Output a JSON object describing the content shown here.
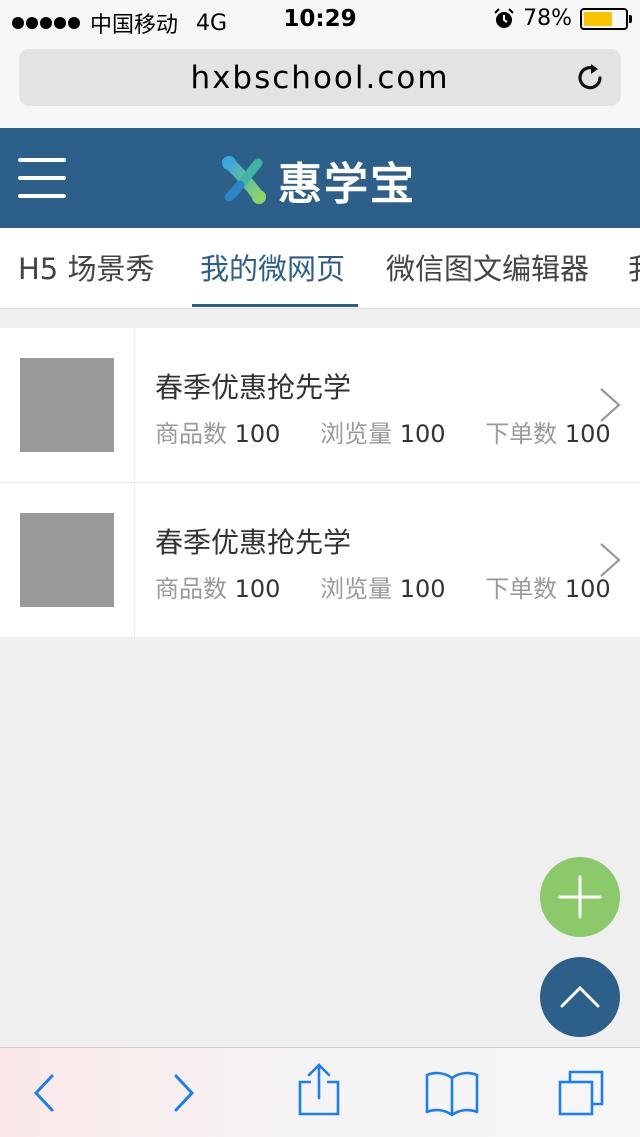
{
  "status_bar": {
    "carrier": "中国移动",
    "network": "4G",
    "time": "10:29",
    "battery": "78%",
    "battery_level": 0.78
  },
  "browser": {
    "url": "hxbschool.com"
  },
  "header": {
    "logo_text": "惠学宝"
  },
  "tabs": [
    {
      "label": "H5 场景秀"
    },
    {
      "label": "我的微网页"
    },
    {
      "label": "微信图文编辑器"
    },
    {
      "label": "我"
    }
  ],
  "list": [
    {
      "title": "春季优惠抢先学",
      "stats": [
        {
          "label": "商品数",
          "value": "100"
        },
        {
          "label": "浏览量",
          "value": "100"
        },
        {
          "label": "下单数",
          "value": "100"
        }
      ]
    },
    {
      "title": "春季优惠抢先学",
      "stats": [
        {
          "label": "商品数",
          "value": "100"
        },
        {
          "label": "浏览量",
          "value": "100"
        },
        {
          "label": "下单数",
          "value": "100"
        }
      ]
    }
  ],
  "colors": {
    "brand": "#2c5f8a",
    "add_button": "#8cc96a",
    "ios_blue": "#1a7ef5"
  },
  "icons": {
    "menu": "hamburger-icon",
    "reload": "reload-icon",
    "chevron": "chevron-right-icon",
    "add": "plus-icon",
    "scroll_top": "chevron-up-icon",
    "back": "back-icon",
    "forward": "forward-icon",
    "share": "share-icon",
    "bookmarks": "book-icon",
    "tabs": "tabs-icon"
  }
}
